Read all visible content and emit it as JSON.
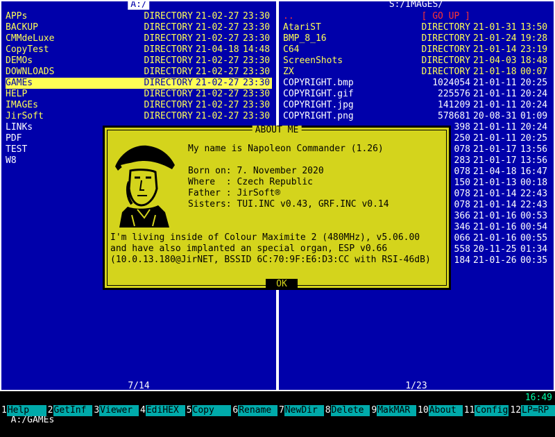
{
  "left_panel": {
    "title": "A:/",
    "footer": "7/14",
    "rows": [
      {
        "name": "APPs",
        "size": "DIRECTORY",
        "date": "21-02-27",
        "time": "23:30"
      },
      {
        "name": "BACKUP",
        "size": "DIRECTORY",
        "date": "21-02-27",
        "time": "23:30"
      },
      {
        "name": "CMMdeLuxe",
        "size": "DIRECTORY",
        "date": "21-02-27",
        "time": "23:30"
      },
      {
        "name": "CopyTest",
        "size": "DIRECTORY",
        "date": "21-04-18",
        "time": "14:48"
      },
      {
        "name": "DEMOs",
        "size": "DIRECTORY",
        "date": "21-02-27",
        "time": "23:30"
      },
      {
        "name": "DOWNLOADS",
        "size": "DIRECTORY",
        "date": "21-02-27",
        "time": "23:30"
      },
      {
        "name": "GAMEs",
        "size": "DIRECTORY",
        "date": "21-02-27",
        "time": "23:30"
      },
      {
        "name": "HELP",
        "size": "DIRECTORY",
        "date": "21-02-27",
        "time": "23:30"
      },
      {
        "name": "IMAGEs",
        "size": "DIRECTORY",
        "date": "21-02-27",
        "time": "23:30"
      },
      {
        "name": "JirSoft",
        "size": "DIRECTORY",
        "date": "21-02-27",
        "time": "23:30"
      },
      {
        "name": "LINKs",
        "size": "",
        "date": "",
        "time": ""
      },
      {
        "name": "PDF",
        "size": "",
        "date": "",
        "time": ""
      },
      {
        "name": "TEST",
        "size": "",
        "date": "",
        "time": ""
      },
      {
        "name": "W8",
        "size": "",
        "date": "",
        "time": ""
      }
    ]
  },
  "right_panel": {
    "title": "S:/IMAGES/",
    "footer": "1/23",
    "rows": [
      {
        "name": "..",
        "size": "[ GO UP ]",
        "date": "",
        "time": ""
      },
      {
        "name": "AtariST",
        "size": "DIRECTORY",
        "date": "21-01-31",
        "time": "13:50"
      },
      {
        "name": "BMP_8_16",
        "size": "DIRECTORY",
        "date": "21-01-24",
        "time": "19:28"
      },
      {
        "name": "C64",
        "size": "DIRECTORY",
        "date": "21-01-14",
        "time": "23:19"
      },
      {
        "name": "ScreenShots",
        "size": "DIRECTORY",
        "date": "21-04-03",
        "time": "18:48"
      },
      {
        "name": "ZX",
        "size": "DIRECTORY",
        "date": "21-01-18",
        "time": "00:07"
      },
      {
        "name": "COPYRIGHT.bmp",
        "size": "1024054",
        "date": "21-01-11",
        "time": "20:25"
      },
      {
        "name": "COPYRIGHT.gif",
        "size": "225576",
        "date": "21-01-11",
        "time": "20:24"
      },
      {
        "name": "COPYRIGHT.jpg",
        "size": "141209",
        "date": "21-01-11",
        "time": "20:24"
      },
      {
        "name": "COPYRIGHT.png",
        "size": "578681",
        "date": "20-08-31",
        "time": "01:09"
      },
      {
        "name": "",
        "size": "398",
        "date": "21-01-11",
        "time": "20:24"
      },
      {
        "name": "",
        "size": "250",
        "date": "21-01-11",
        "time": "20:25"
      },
      {
        "name": "",
        "size": "078",
        "date": "21-01-17",
        "time": "13:56"
      },
      {
        "name": "",
        "size": "283",
        "date": "21-01-17",
        "time": "13:56"
      },
      {
        "name": "",
        "size": "078",
        "date": "21-04-18",
        "time": "16:47"
      },
      {
        "name": "",
        "size": "150",
        "date": "21-01-13",
        "time": "00:18"
      },
      {
        "name": "",
        "size": "078",
        "date": "21-01-14",
        "time": "22:43"
      },
      {
        "name": "",
        "size": "078",
        "date": "21-01-14",
        "time": "22:43"
      },
      {
        "name": "",
        "size": "366",
        "date": "21-01-16",
        "time": "00:53"
      },
      {
        "name": "",
        "size": "346",
        "date": "21-01-16",
        "time": "00:54"
      },
      {
        "name": "",
        "size": "066",
        "date": "21-01-16",
        "time": "00:55"
      },
      {
        "name": "",
        "size": "558",
        "date": "20-11-25",
        "time": "01:34"
      },
      {
        "name": "",
        "size": "184",
        "date": "21-01-26",
        "time": "00:35"
      }
    ]
  },
  "command_line": {
    "path": "A:/GAMEs",
    "clock": "16:49"
  },
  "function_keys": [
    {
      "num": "1",
      "label": "Help"
    },
    {
      "num": "2",
      "label": "GetInf"
    },
    {
      "num": "3",
      "label": "Viewer"
    },
    {
      "num": "4",
      "label": "EdiHEX"
    },
    {
      "num": "5",
      "label": "Copy"
    },
    {
      "num": "6",
      "label": "Rename"
    },
    {
      "num": "7",
      "label": "NewDir"
    },
    {
      "num": "8",
      "label": "Delete"
    },
    {
      "num": "9",
      "label": "MakMAR"
    },
    {
      "num": "10",
      "label": "About"
    },
    {
      "num": "11",
      "label": "Config"
    },
    {
      "num": "12",
      "label": "LP=RP"
    }
  ],
  "about_dialog": {
    "title": "ABOUT ME",
    "intro": "My name is Napoleon Commander (1.26)",
    "born": "Born on: 7. November 2020",
    "where": "Where  : Czech Republic",
    "father": "Father : JirSoft®",
    "sisters": "Sisters: TUI.INC v0.43, GRF.INC v0.14",
    "line1": "I'm living inside of Colour Maximite 2 (480MHz), v5.06.00",
    "line2": "and have also implanted an special organ, ESP v0.66",
    "line3": "(10.0.13.180@JirNET, BSSID 6C:70:9F:E6:D3:CC with RSI-46dB)",
    "ok": "OK"
  },
  "colors": {
    "panel_bg": "#0000aa",
    "directory": "#ffff55",
    "file": "#ffffff",
    "dialog_bg": "#d4d41c",
    "fkey_bg": "#00aaaa"
  }
}
